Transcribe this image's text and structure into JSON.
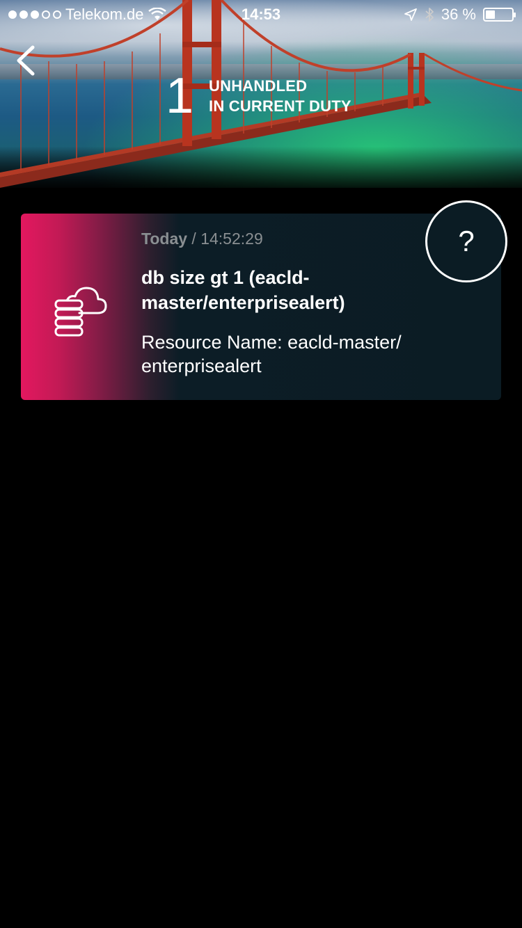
{
  "status_bar": {
    "carrier": "Telekom.de",
    "time": "14:53",
    "battery_text": "36 %",
    "battery_level": 0.36,
    "signal_bars_filled": 3,
    "signal_bars_total": 5
  },
  "header": {
    "count": "1",
    "label_line1": "UNHANDLED",
    "label_line2": "IN CURRENT DUTY"
  },
  "alert": {
    "day": "Today",
    "separator": " / ",
    "time": "14:52:29",
    "title": "db size gt 1 (eacld-master/enterprisealert)",
    "resource": "Resource Name: eacld-master/ enterprisealert",
    "icon": "cloud-database-icon"
  },
  "help_button": {
    "label": "?"
  },
  "colors": {
    "accent": "#e3185f",
    "card_bg": "#0b1c24",
    "timestamp": "#8a8f92"
  }
}
